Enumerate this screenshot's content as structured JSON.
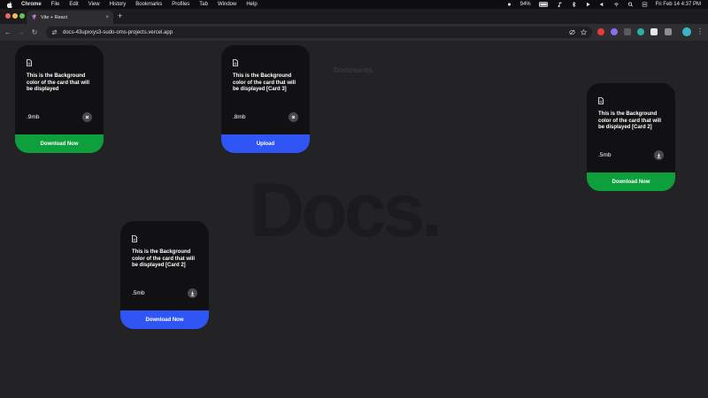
{
  "menubar": {
    "items": [
      "Chrome",
      "File",
      "Edit",
      "View",
      "History",
      "Bookmarks",
      "Profiles",
      "Tab",
      "Window",
      "Help"
    ],
    "battery": "94%",
    "datetime": "Fri Feb 14  4:37 PM"
  },
  "browser": {
    "tab_title": "Vite + React",
    "new_tab_symbol": "+",
    "close_symbol": "×",
    "url": "docs-43upxxys3-sudo-oms-projects.vercel.app"
  },
  "page": {
    "big_title": "Docs.",
    "small_title": "Documents.",
    "cards": [
      {
        "desc": "This is the Background color of the card that will be displayed",
        "size": ".9mb",
        "action_icon": "close-icon",
        "cta": "Download Now",
        "cta_color": "#0d9f3c"
      },
      {
        "desc": "This is the Background color of the card that will be displayed [Card 3]",
        "size": ".8mb",
        "action_icon": "close-icon",
        "cta": "Upload",
        "cta_color": "#2f55f5"
      },
      {
        "desc": "This is the Background color of the card that will be displayed [Card 2]",
        "size": ".5mb",
        "action_icon": "download-icon",
        "cta": "Download Now",
        "cta_color": "#0d9f3c"
      },
      {
        "desc": "This is the Background color of the card that will be displayed [Card 2]",
        "size": ".5mb",
        "action_icon": "download-icon",
        "cta": "Download Now",
        "cta_color": "#2f55f5"
      }
    ]
  }
}
